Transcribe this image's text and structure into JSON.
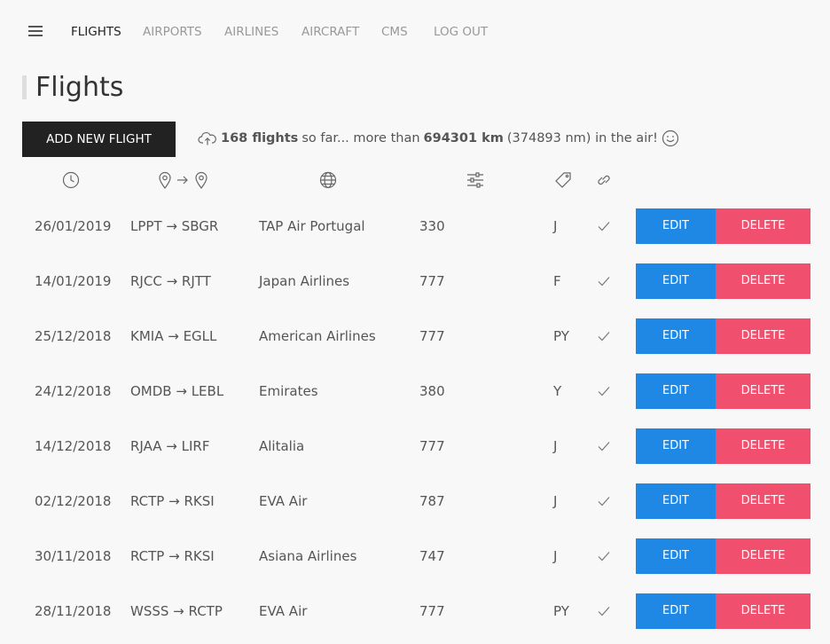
{
  "nav": {
    "items": [
      {
        "label": "FLIGHTS",
        "active": true
      },
      {
        "label": "AIRPORTS",
        "active": false
      },
      {
        "label": "AIRLINES",
        "active": false
      },
      {
        "label": "AIRCRAFT",
        "active": false
      },
      {
        "label": "CMS",
        "active": false
      },
      {
        "label": "LOG OUT",
        "active": false
      }
    ]
  },
  "page": {
    "title": "Flights",
    "add_button_label": "ADD NEW FLIGHT"
  },
  "stats": {
    "flights": "168 flights",
    "text1": "so far... more than",
    "km": "694301 km",
    "text2": "(374893 nm) in the air!"
  },
  "table": {
    "header_icons": [
      "clock-icon",
      "origin-pin-icon",
      "destination-pin-icon",
      "globe-icon",
      "sliders-icon",
      "tag-icon",
      "link-icon"
    ],
    "rows": [
      {
        "date": "26/01/2019",
        "from": "LPPT",
        "to": "SBGR",
        "airline": "TAP Air Portugal",
        "aircraft": "330",
        "class": "J"
      },
      {
        "date": "14/01/2019",
        "from": "RJCC",
        "to": "RJTT",
        "airline": "Japan Airlines",
        "aircraft": "777",
        "class": "F"
      },
      {
        "date": "25/12/2018",
        "from": "KMIA",
        "to": "EGLL",
        "airline": "American Airlines",
        "aircraft": "777",
        "class": "PY"
      },
      {
        "date": "24/12/2018",
        "from": "OMDB",
        "to": "LEBL",
        "airline": "Emirates",
        "aircraft": "380",
        "class": "Y"
      },
      {
        "date": "14/12/2018",
        "from": "RJAA",
        "to": "LIRF",
        "airline": "Alitalia",
        "aircraft": "777",
        "class": "J"
      },
      {
        "date": "02/12/2018",
        "from": "RCTP",
        "to": "RKSI",
        "airline": "EVA Air",
        "aircraft": "787",
        "class": "J"
      },
      {
        "date": "30/11/2018",
        "from": "RCTP",
        "to": "RKSI",
        "airline": "Asiana Airlines",
        "aircraft": "747",
        "class": "J"
      },
      {
        "date": "28/11/2018",
        "from": "WSSS",
        "to": "RCTP",
        "airline": "EVA Air",
        "aircraft": "777",
        "class": "PY"
      }
    ],
    "edit_label": "EDIT",
    "delete_label": "DELETE"
  },
  "colors": {
    "edit": "#1f88e5",
    "delete": "#f0506e",
    "primary_button": "#222222",
    "background": "#f8f8f8"
  }
}
